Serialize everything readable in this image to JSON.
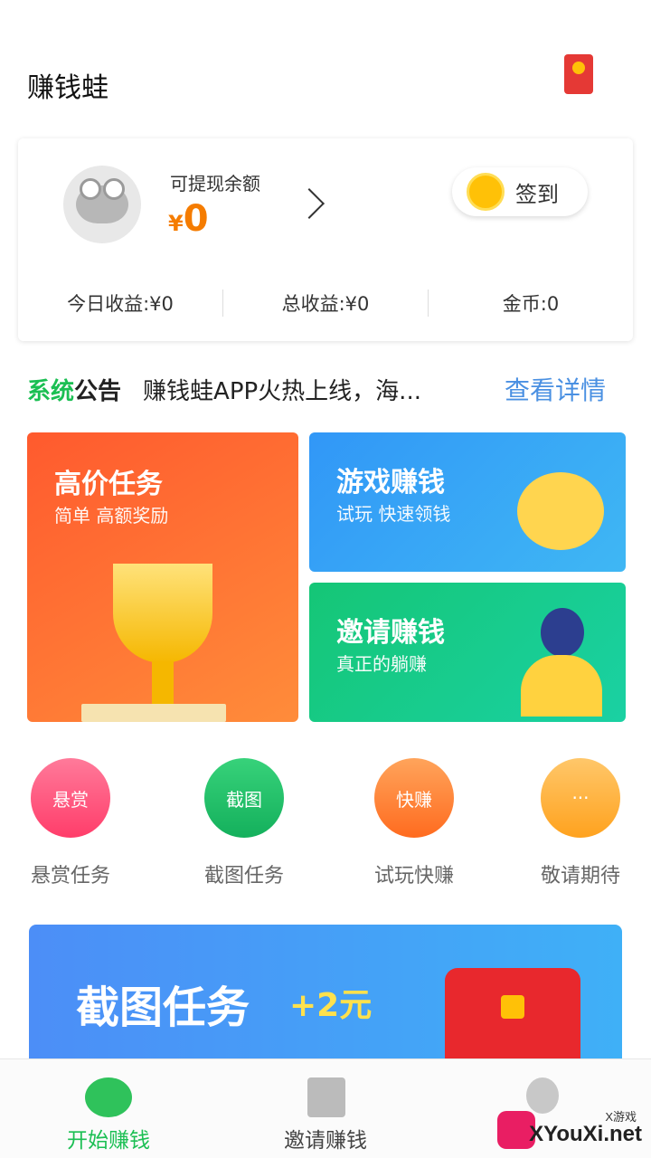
{
  "header": {
    "title": "赚钱蛙"
  },
  "balance": {
    "label": "可提现余额",
    "currency": "¥",
    "amount": "0",
    "signin": "签到",
    "today": "今日收益:¥0",
    "total": "总收益:¥0",
    "coins": "金币:0"
  },
  "notice": {
    "badge_green": "系统",
    "badge_black": "公告",
    "text": "赚钱蛙APP火热上线，海...",
    "link": "查看详情"
  },
  "cards": {
    "high": {
      "title": "高价任务",
      "sub": "简单 高额奖励"
    },
    "game": {
      "title": "游戏赚钱",
      "sub": "试玩 快速领钱"
    },
    "invite": {
      "title": "邀请赚钱",
      "sub": "真正的躺赚"
    }
  },
  "quick": [
    {
      "badge": "悬赏",
      "label": "悬赏任务"
    },
    {
      "badge": "截图",
      "label": "截图任务"
    },
    {
      "badge": "快赚",
      "label": "试玩快赚"
    },
    {
      "badge": "···",
      "label": "敬请期待"
    }
  ],
  "banner": {
    "title": "截图任务",
    "plus": "+2元"
  },
  "nav": [
    {
      "label": "开始赚钱",
      "active": true
    },
    {
      "label": "邀请赚钱",
      "active": false
    },
    {
      "label": "",
      "active": false
    }
  ],
  "watermark": {
    "small": "X游戏",
    "big": "XYouXi.net"
  }
}
